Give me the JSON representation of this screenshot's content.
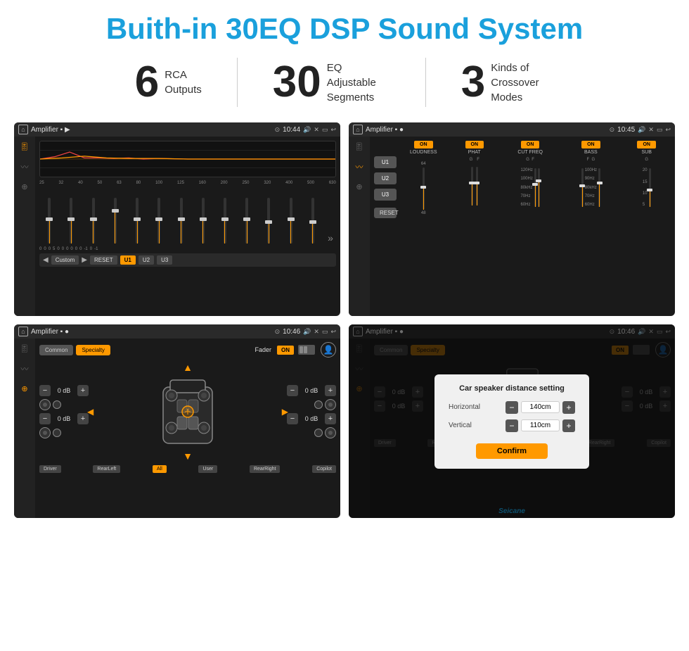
{
  "title": "Buith-in 30EQ DSP Sound System",
  "stats": [
    {
      "number": "6",
      "desc": "RCA\nOutputs"
    },
    {
      "number": "30",
      "desc": "EQ Adjustable\nSegments"
    },
    {
      "number": "3",
      "desc": "Kinds of\nCrossover Modes"
    }
  ],
  "screens": [
    {
      "id": "eq-screen",
      "statusBar": {
        "title": "Amplifier",
        "time": "10:44"
      },
      "type": "eq"
    },
    {
      "id": "amp-screen",
      "statusBar": {
        "title": "Amplifier",
        "time": "10:45"
      },
      "type": "amplifier"
    },
    {
      "id": "fader-screen",
      "statusBar": {
        "title": "Amplifier",
        "time": "10:46"
      },
      "type": "fader"
    },
    {
      "id": "fader-dialog-screen",
      "statusBar": {
        "title": "Amplifier",
        "time": "10:46"
      },
      "type": "fader-dialog"
    }
  ],
  "eq": {
    "frequencies": [
      "25",
      "32",
      "40",
      "50",
      "63",
      "80",
      "100",
      "125",
      "160",
      "200",
      "250",
      "320",
      "400",
      "500",
      "630"
    ],
    "values": [
      "0",
      "0",
      "0",
      "5",
      "0",
      "0",
      "0",
      "0",
      "0",
      "0",
      "-1",
      "0",
      "-1"
    ],
    "bottomButtons": [
      "Custom",
      "RESET",
      "U1",
      "U2",
      "U3"
    ]
  },
  "amplifier": {
    "presets": [
      "U1",
      "U2",
      "U3"
    ],
    "channels": [
      "LOUDNESS",
      "PHAT",
      "CUT FREQ",
      "BASS",
      "SUB"
    ],
    "resetLabel": "RESET"
  },
  "fader": {
    "tabs": [
      "Common",
      "Specialty"
    ],
    "title": "Fader",
    "onLabel": "ON",
    "controls": [
      "0 dB",
      "0 dB",
      "0 dB",
      "0 dB"
    ],
    "zones": [
      "Driver",
      "RearLeft",
      "All",
      "User",
      "RearRight",
      "Copilot"
    ]
  },
  "dialog": {
    "title": "Car speaker distance setting",
    "horizontal": {
      "label": "Horizontal",
      "value": "140cm"
    },
    "vertical": {
      "label": "Vertical",
      "value": "110cm"
    },
    "confirmLabel": "Confirm"
  },
  "watermark": "Seicane"
}
